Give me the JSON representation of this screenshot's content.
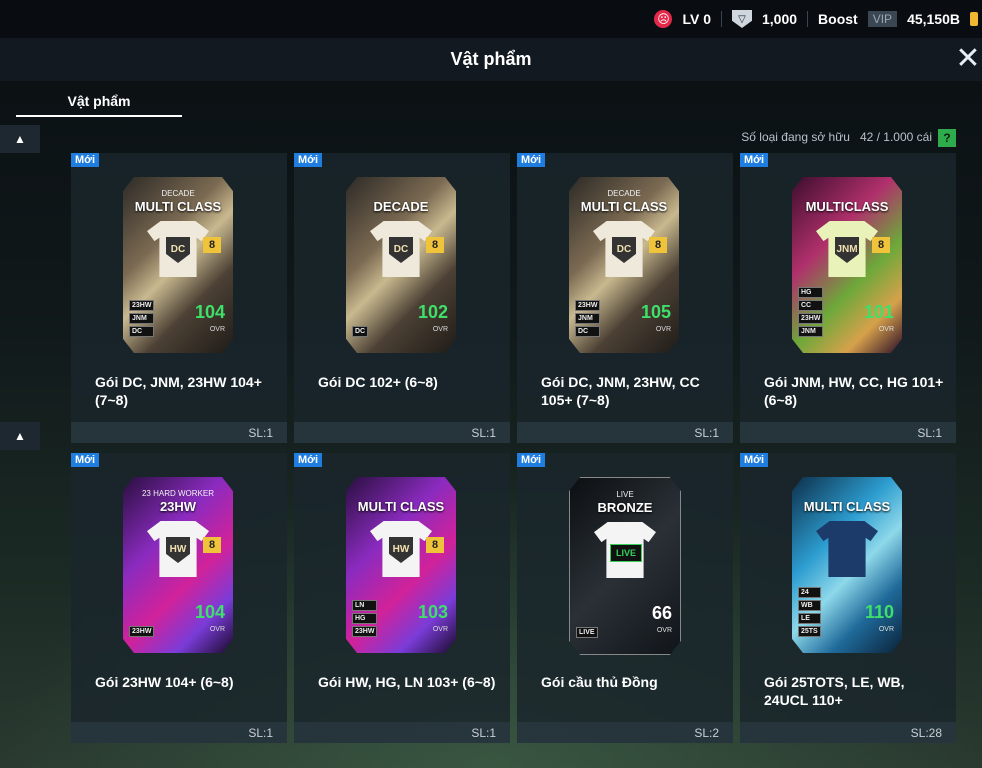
{
  "topbar": {
    "level": "LV 0",
    "shield_value": "1,000",
    "boost_label": "Boost",
    "vip_label": "VIP",
    "currency": "45,150B"
  },
  "header": {
    "title": "Vật phẩm"
  },
  "tabs": [
    {
      "label": "Vật phẩm"
    }
  ],
  "owned": {
    "label": "Số loại đang sở hữu",
    "count": "42 / 1.000 cái",
    "help": "?"
  },
  "items": [
    {
      "badge": "Mới",
      "name": "Gói DC, JNM, 23HW 104+ (7~8)",
      "qty": "SL:1",
      "pack_sub": "DECADE",
      "pack_label": "MULTI CLASS",
      "crest": "DC",
      "number": "8",
      "ovr": "104",
      "ovr_label": "OVR",
      "tags": [
        "23HW",
        "JNM",
        "DC"
      ],
      "style": "gold",
      "shirt": "",
      "crest_type": "crest"
    },
    {
      "badge": "Mới",
      "name": "Gói DC 102+ (6~8)",
      "qty": "SL:1",
      "pack_sub": "",
      "pack_label": "DECADE",
      "crest": "DC",
      "number": "8",
      "ovr": "102",
      "ovr_label": "OVR",
      "tags": [
        "DC"
      ],
      "style": "gold",
      "shirt": "",
      "crest_type": "crest"
    },
    {
      "badge": "Mới",
      "name": "Gói DC, JNM, 23HW, CC 105+ (7~8)",
      "qty": "SL:1",
      "pack_sub": "DECADE",
      "pack_label": "MULTI CLASS",
      "crest": "DC",
      "number": "8",
      "ovr": "105",
      "ovr_label": "OVR",
      "tags": [
        "23HW",
        "JNM",
        "DC"
      ],
      "style": "gold",
      "shirt": "",
      "crest_type": "crest"
    },
    {
      "badge": "Mới",
      "name": "Gói JNM, HW, CC, HG 101+ (6~8)",
      "qty": "SL:1",
      "pack_sub": "",
      "pack_label": "MULTICLASS",
      "crest": "JNM",
      "number": "8",
      "ovr": "101",
      "ovr_label": "OVR",
      "tags": [
        "HG",
        "CC",
        "23HW",
        "JNM"
      ],
      "style": "magenta",
      "shirt": "green",
      "crest_type": "crest"
    },
    {
      "badge": "Mới",
      "name": "Gói 23HW 104+ (6~8)",
      "qty": "SL:1",
      "pack_sub": "23 HARD WORKER",
      "pack_label": "23HW",
      "crest": "HW",
      "number": "8",
      "ovr": "104",
      "ovr_label": "OVR",
      "tags": [
        "23HW"
      ],
      "style": "purple",
      "shirt": "white",
      "crest_type": "crest"
    },
    {
      "badge": "Mới",
      "name": "Gói HW, HG, LN 103+ (6~8)",
      "qty": "SL:1",
      "pack_sub": "",
      "pack_label": "MULTI CLASS",
      "crest": "HW",
      "number": "8",
      "ovr": "103",
      "ovr_label": "OVR",
      "tags": [
        "LN",
        "HG",
        "23HW"
      ],
      "style": "purple",
      "shirt": "white",
      "crest_type": "crest"
    },
    {
      "badge": "Mới",
      "name": "Gói cầu thủ Đồng",
      "qty": "SL:2",
      "pack_sub": "LIVE",
      "pack_label": "BRONZE",
      "crest": "LIVE",
      "number": "",
      "ovr": "66",
      "ovr_label": "OVR",
      "tags": [
        "LIVE"
      ],
      "style": "dark",
      "shirt": "white",
      "crest_type": "live",
      "ovr_white": true
    },
    {
      "badge": "Mới",
      "name": "Gói 25TOTS, LE, WB, 24UCL 110+",
      "qty": "SL:28",
      "pack_sub": "",
      "pack_label": "MULTI CLASS",
      "crest": "",
      "number": "",
      "ovr": "110",
      "ovr_label": "OVR",
      "tags": [
        "24",
        "WB",
        "LE",
        "25TS"
      ],
      "style": "blue",
      "shirt": "navy",
      "crest_type": "none"
    }
  ],
  "colors": {
    "accent_green": "#3ee06a",
    "new_badge": "#1f7de0",
    "help_green": "#2eab4a",
    "sad_red": "#e3284a"
  },
  "icons": {
    "close": "close-icon",
    "scroll_up": "arrow-up-icon",
    "level": "sad-face-icon",
    "shield": "shield-icon",
    "coin": "coin-icon"
  }
}
